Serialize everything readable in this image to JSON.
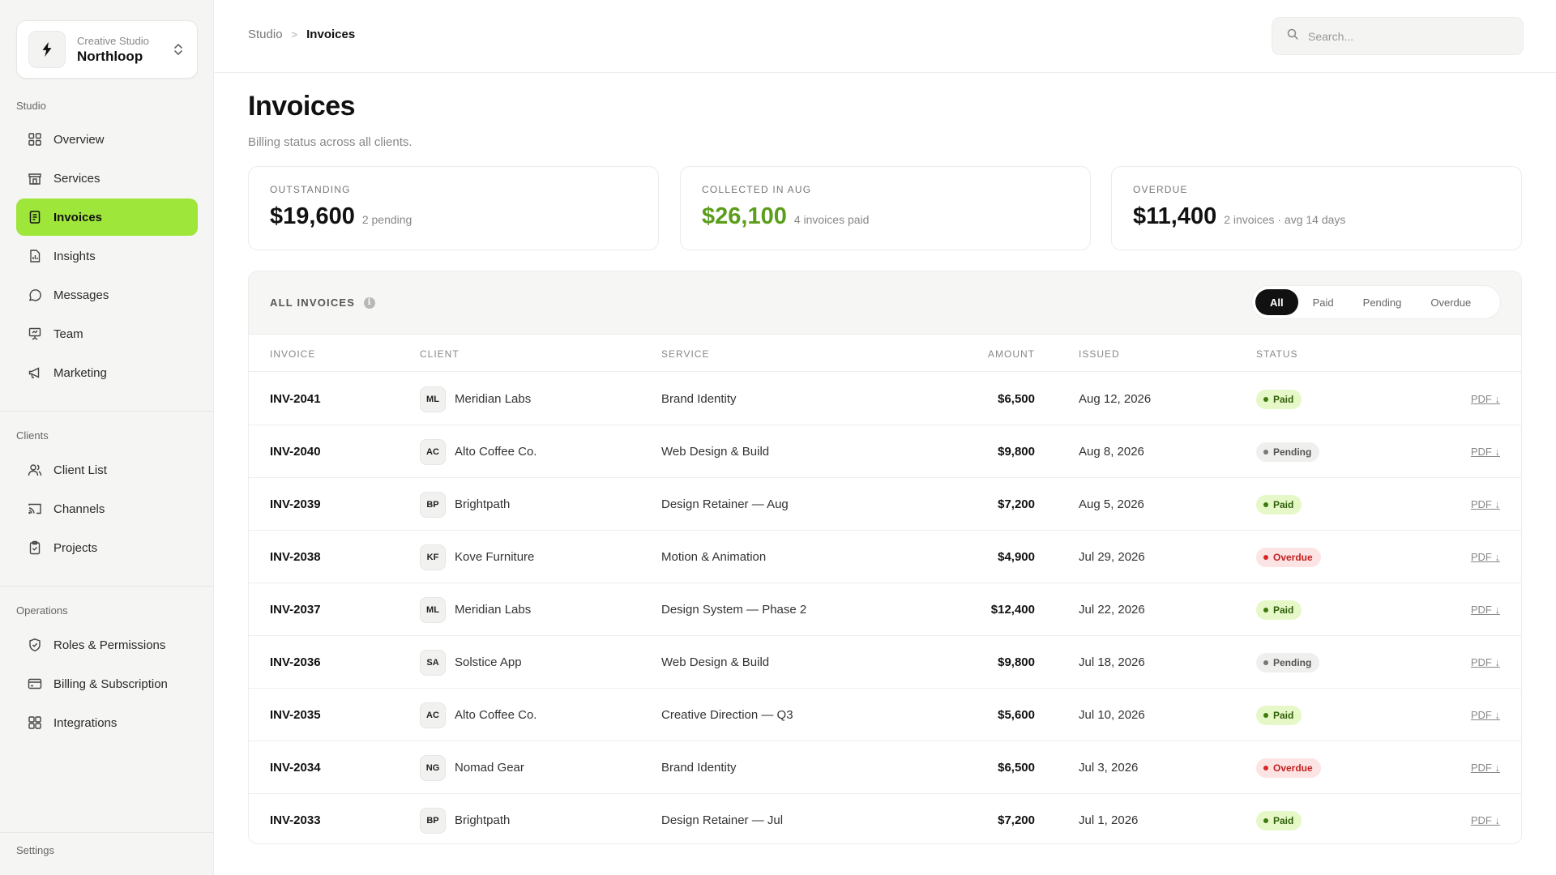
{
  "workspace": {
    "subtitle": "Creative Studio",
    "name": "Northloop"
  },
  "sidebar": {
    "sections": [
      {
        "title": "Studio",
        "items": [
          {
            "label": "Overview",
            "icon": "grid-icon"
          },
          {
            "label": "Services",
            "icon": "store-icon"
          },
          {
            "label": "Invoices",
            "icon": "document-icon",
            "active": true
          },
          {
            "label": "Insights",
            "icon": "chart-file-icon"
          },
          {
            "label": "Messages",
            "icon": "chat-icon"
          },
          {
            "label": "Team",
            "icon": "presentation-icon"
          },
          {
            "label": "Marketing",
            "icon": "megaphone-icon"
          }
        ]
      },
      {
        "title": "Clients",
        "items": [
          {
            "label": "Client List",
            "icon": "users-icon"
          },
          {
            "label": "Channels",
            "icon": "cast-icon"
          },
          {
            "label": "Projects",
            "icon": "clipboard-check-icon"
          }
        ]
      },
      {
        "title": "Operations",
        "items": [
          {
            "label": "Roles & Permissions",
            "icon": "shield-check-icon"
          },
          {
            "label": "Billing & Subscription",
            "icon": "credit-card-icon"
          },
          {
            "label": "Integrations",
            "icon": "blocks-icon"
          }
        ]
      }
    ],
    "settings_label": "Settings"
  },
  "breadcrumb": {
    "parent": "Studio",
    "separator": ">",
    "current": "Invoices"
  },
  "search": {
    "placeholder": "Search..."
  },
  "page": {
    "title": "Invoices",
    "subtitle": "Billing status across all clients."
  },
  "stats": [
    {
      "label": "OUTSTANDING",
      "value": "$19,600",
      "note": "2 pending",
      "color": "#111111"
    },
    {
      "label": "COLLECTED IN AUG",
      "value": "$26,100",
      "note": "4 invoices paid",
      "color": "#5a9e1c"
    },
    {
      "label": "OVERDUE",
      "value": "$11,400",
      "note": "2 invoices · avg 14 days",
      "color": "#111111"
    }
  ],
  "table": {
    "title": "ALL INVOICES",
    "filters": [
      {
        "label": "All",
        "active": true
      },
      {
        "label": "Paid"
      },
      {
        "label": "Pending"
      },
      {
        "label": "Overdue"
      }
    ],
    "columns": {
      "invoice": "INVOICE",
      "client": "CLIENT",
      "service": "SERVICE",
      "amount": "AMOUNT",
      "issued": "ISSUED",
      "status": "STATUS"
    },
    "pdf_label": "PDF ↓",
    "rows": [
      {
        "invoice": "INV-2041",
        "initials": "ML",
        "client": "Meridian Labs",
        "service": "Brand Identity",
        "amount": "$6,500",
        "issued": "Aug 12, 2026",
        "status": "Paid"
      },
      {
        "invoice": "INV-2040",
        "initials": "AC",
        "client": "Alto Coffee Co.",
        "service": "Web Design & Build",
        "amount": "$9,800",
        "issued": "Aug 8, 2026",
        "status": "Pending"
      },
      {
        "invoice": "INV-2039",
        "initials": "BP",
        "client": "Brightpath",
        "service": "Design Retainer — Aug",
        "amount": "$7,200",
        "issued": "Aug 5, 2026",
        "status": "Paid"
      },
      {
        "invoice": "INV-2038",
        "initials": "KF",
        "client": "Kove Furniture",
        "service": "Motion & Animation",
        "amount": "$4,900",
        "issued": "Jul 29, 2026",
        "status": "Overdue"
      },
      {
        "invoice": "INV-2037",
        "initials": "ML",
        "client": "Meridian Labs",
        "service": "Design System — Phase 2",
        "amount": "$12,400",
        "issued": "Jul 22, 2026",
        "status": "Paid"
      },
      {
        "invoice": "INV-2036",
        "initials": "SA",
        "client": "Solstice App",
        "service": "Web Design & Build",
        "amount": "$9,800",
        "issued": "Jul 18, 2026",
        "status": "Pending"
      },
      {
        "invoice": "INV-2035",
        "initials": "AC",
        "client": "Alto Coffee Co.",
        "service": "Creative Direction — Q3",
        "amount": "$5,600",
        "issued": "Jul 10, 2026",
        "status": "Paid"
      },
      {
        "invoice": "INV-2034",
        "initials": "NG",
        "client": "Nomad Gear",
        "service": "Brand Identity",
        "amount": "$6,500",
        "issued": "Jul 3, 2026",
        "status": "Overdue"
      },
      {
        "invoice": "INV-2033",
        "initials": "BP",
        "client": "Brightpath",
        "service": "Design Retainer — Jul",
        "amount": "$7,200",
        "issued": "Jul 1, 2026",
        "status": "Paid"
      }
    ]
  }
}
